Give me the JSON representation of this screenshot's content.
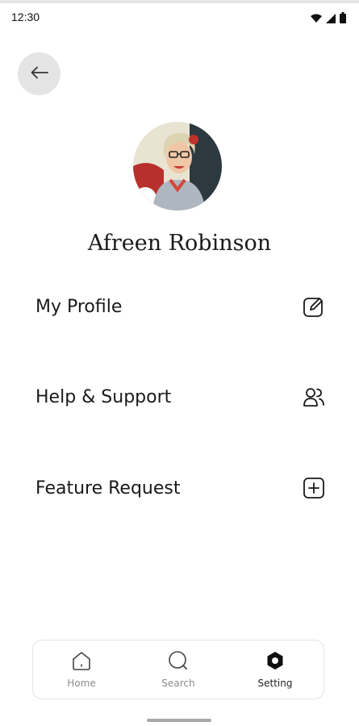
{
  "status_bar": {
    "time": "12:30",
    "icons": [
      "wifi-icon",
      "signal-icon",
      "battery-icon"
    ]
  },
  "header": {
    "back_icon": "arrow-left-icon"
  },
  "profile": {
    "name": "Afreen Robinson",
    "avatar_icon": "user-photo"
  },
  "menu": {
    "items": [
      {
        "label": "My Profile",
        "icon": "edit-icon"
      },
      {
        "label": "Help & Support",
        "icon": "users-icon"
      },
      {
        "label": "Feature Request",
        "icon": "plus-square-icon"
      }
    ]
  },
  "bottom_nav": {
    "items": [
      {
        "label": "Home",
        "icon": "home-icon",
        "active": false
      },
      {
        "label": "Search",
        "icon": "search-icon",
        "active": false
      },
      {
        "label": "Setting",
        "icon": "settings-icon",
        "active": true
      }
    ]
  },
  "colors": {
    "background": "#ffffff",
    "text": "#1a1a1a",
    "back_button_bg": "#e4e4e4",
    "nav_inactive": "#8a8a8a",
    "nav_active": "#222222"
  }
}
